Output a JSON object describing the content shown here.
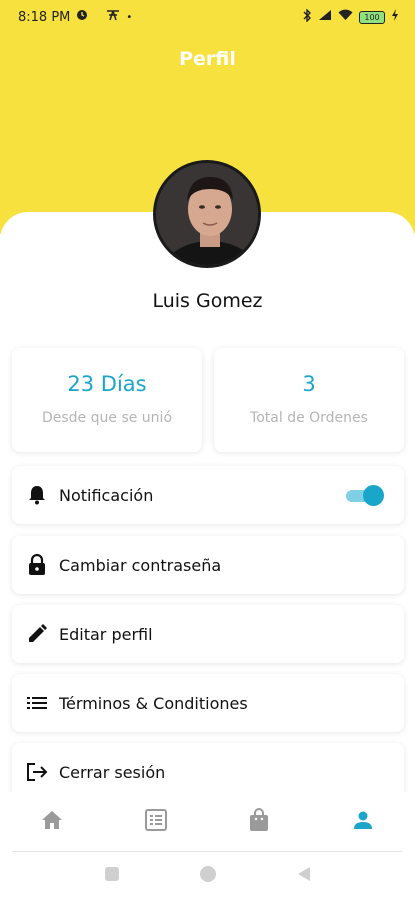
{
  "status_bar": {
    "time": "8:18 PM",
    "battery": "100",
    "icons": [
      "data-saver-icon",
      "app-icon",
      "dot-icon",
      "bluetooth-icon",
      "signal-icon",
      "wifi-icon",
      "battery-icon",
      "charging-icon"
    ]
  },
  "header": {
    "title": "Perfil",
    "color": "#f7e13e"
  },
  "profile": {
    "name": "Luis Gomez"
  },
  "stats": [
    {
      "value": "23 Días",
      "label": "Desde que se unió"
    },
    {
      "value": "3",
      "label": "Total de Ordenes"
    }
  ],
  "menu": [
    {
      "label": "Notificación",
      "icon": "bell-icon",
      "toggle": true
    },
    {
      "label": "Cambiar contraseña",
      "icon": "lock-icon"
    },
    {
      "label": "Editar perfil",
      "icon": "pencil-icon"
    },
    {
      "label": "Términos & Conditiones",
      "icon": "list-icon"
    },
    {
      "label": "Cerrar sesión",
      "icon": "logout-icon"
    }
  ],
  "bottom_nav": [
    {
      "icon": "home-icon",
      "active": false
    },
    {
      "icon": "orders-icon",
      "active": false
    },
    {
      "icon": "bag-icon",
      "active": false
    },
    {
      "icon": "person-icon",
      "active": true
    }
  ],
  "system_nav": [
    "recents-icon",
    "home-circle-icon",
    "back-icon"
  ],
  "colors": {
    "accent": "#1aa6c9",
    "header": "#f7e13e",
    "inactive_icon": "#9a9a9a",
    "muted_text": "#b5b5b5"
  }
}
